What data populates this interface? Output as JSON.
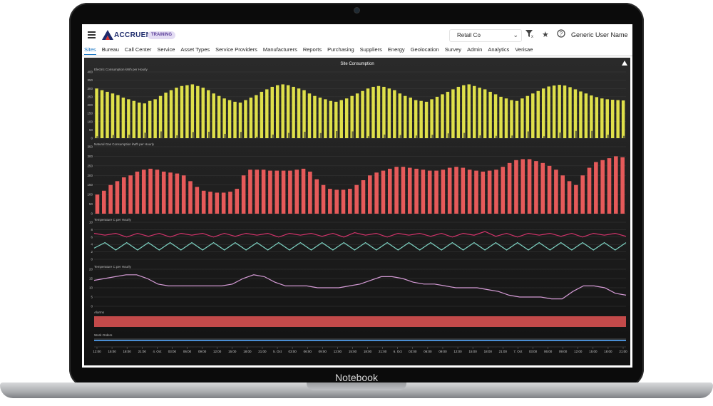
{
  "device": {
    "brand": "Notebook"
  },
  "app": {
    "logo_text": "ACCRUENT",
    "env_badge": "TRAINING",
    "company_select": "Retail Co",
    "user_name": "Generic User Name",
    "icons": {
      "menu": "hamburger-icon",
      "filter": "filter-icon",
      "favorite": "star-icon",
      "help": "help-icon"
    }
  },
  "nav": {
    "items": [
      {
        "label": "Sites",
        "active": true
      },
      {
        "label": "Bureau"
      },
      {
        "label": "Call Center"
      },
      {
        "label": "Service"
      },
      {
        "label": "Asset Types"
      },
      {
        "label": "Service Providers"
      },
      {
        "label": "Manufacturers"
      },
      {
        "label": "Reports"
      },
      {
        "label": "Purchasing"
      },
      {
        "label": "Suppliers"
      },
      {
        "label": "Energy"
      },
      {
        "label": "Geolocation"
      },
      {
        "label": "Survey"
      },
      {
        "label": "Admin"
      },
      {
        "label": "Analytics"
      },
      {
        "label": "Verisae"
      }
    ]
  },
  "chart_data": {
    "type": "line",
    "title": "Site Consumption",
    "colors": {
      "electric": "#dfe04a",
      "electric_secondary": "#6b6b3a",
      "gas": "#e65a5a",
      "temp_high": "#d6336c",
      "temp_low": "#7ed3c3",
      "temp_single": "#d59bd6",
      "alarms": "#c34a4a",
      "work_orders": "#4a8ed4"
    },
    "x_ticks": [
      "12:00",
      "15:00",
      "18:00",
      "21:00",
      "4. Oct",
      "03:00",
      "06:00",
      "09:00",
      "12:00",
      "15:00",
      "18:00",
      "21:00",
      "5. Oct",
      "03:00",
      "06:00",
      "09:00",
      "12:00",
      "15:00",
      "18:00",
      "21:00",
      "6. Oct",
      "03:00",
      "06:00",
      "09:00",
      "12:00",
      "15:00",
      "18:00",
      "21:00",
      "7. Oct",
      "03:00",
      "06:00",
      "09:00",
      "12:00",
      "15:00",
      "18:00",
      "21:00"
    ],
    "panels": [
      {
        "key": "electric",
        "label": "Electric Consumption kWh per Hourly",
        "yticks": [
          "400",
          "350",
          "300",
          "250",
          "200",
          "150",
          "100",
          "50",
          "0"
        ],
        "ymax": 400,
        "type": "bar",
        "values": [
          300,
          290,
          280,
          270,
          260,
          245,
          235,
          225,
          215,
          210,
          225,
          235,
          255,
          275,
          290,
          305,
          315,
          320,
          325,
          315,
          305,
          290,
          270,
          255,
          240,
          230,
          220,
          215,
          230,
          245,
          260,
          280,
          295,
          310,
          320,
          325,
          320,
          310,
          300,
          290,
          270,
          255,
          245,
          235,
          225,
          220,
          230,
          240,
          255,
          270,
          285,
          300,
          310,
          315,
          310,
          300,
          290,
          270,
          255,
          245,
          230,
          225,
          220,
          235,
          250,
          265,
          280,
          295,
          310,
          320,
          325,
          315,
          305,
          295,
          280,
          265,
          250,
          240,
          230,
          225,
          240,
          255,
          270,
          285,
          300,
          312,
          318,
          322,
          318,
          308,
          295,
          282,
          270,
          258,
          248,
          240,
          235,
          232,
          230,
          228
        ]
      },
      {
        "key": "gas",
        "label": "Natural Gas Consumption kWh per Hourly",
        "yticks": [
          "350",
          "300",
          "250",
          "200",
          "150",
          "100",
          "50",
          "0"
        ],
        "ymax": 350,
        "type": "bar",
        "values": [
          100,
          120,
          150,
          170,
          190,
          200,
          220,
          230,
          235,
          230,
          220,
          215,
          210,
          200,
          170,
          140,
          120,
          115,
          110,
          110,
          115,
          130,
          200,
          230,
          230,
          230,
          225,
          225,
          225,
          225,
          230,
          235,
          220,
          180,
          150,
          130,
          125,
          125,
          130,
          150,
          175,
          200,
          215,
          225,
          235,
          245,
          245,
          240,
          235,
          230,
          225,
          225,
          230,
          240,
          245,
          240,
          230,
          225,
          220,
          225,
          230,
          245,
          265,
          280,
          285,
          285,
          275,
          265,
          250,
          230,
          200,
          170,
          150,
          200,
          240,
          270,
          280,
          290,
          300,
          295
        ]
      },
      {
        "key": "temp_dual",
        "label": "Temperature C per Hourly",
        "yticks": [
          "10",
          "8",
          "6",
          "4",
          "2",
          "0"
        ],
        "ymax": 10,
        "type": "line",
        "high": [
          7,
          6.5,
          7,
          6,
          7,
          6.2,
          7,
          6,
          7,
          6.5,
          7,
          6,
          7,
          6.2,
          7,
          6.5,
          7,
          6,
          7,
          6.5,
          7,
          6.2,
          7,
          6,
          7.2,
          6.5,
          7,
          6,
          7,
          6.5,
          7,
          6.2,
          7,
          6,
          7,
          6.5,
          7.5,
          6.2,
          7,
          6,
          7,
          6.5,
          7,
          6.2,
          7,
          6,
          7,
          6.5,
          7,
          6.2
        ],
        "low": [
          3,
          4.5,
          2.5,
          4.5,
          2.5,
          4.5,
          2.5,
          4.5,
          2.5,
          4.5,
          2.5,
          4.5,
          2.5,
          4.5,
          2.5,
          4.5,
          2.5,
          4.5,
          2.5,
          4.5,
          2.5,
          4.5,
          2.5,
          4.5,
          2.5,
          4.5,
          2.5,
          4.5,
          2.5,
          4.5,
          2.5,
          4.5,
          2.5,
          4.5,
          2.5,
          4.5,
          2.5,
          4.5,
          2.5,
          4.5,
          2.5,
          4.5,
          2.5,
          4.5,
          2.5,
          4.5,
          2.5,
          4.5,
          2.5,
          4.5
        ]
      },
      {
        "key": "temp_single",
        "label": "Temperature C per Hourly",
        "yticks": [
          "20",
          "15",
          "10",
          "5",
          "0"
        ],
        "ymax": 20,
        "type": "line",
        "values": [
          14,
          15,
          16,
          17,
          17,
          15,
          12,
          11,
          11,
          11,
          11,
          11,
          11,
          12,
          15,
          17,
          16,
          13,
          11,
          11,
          11,
          10,
          10,
          10,
          11,
          12,
          14,
          16,
          16,
          15,
          13,
          12,
          12,
          11,
          10,
          10,
          10,
          9,
          8,
          6,
          5,
          5,
          5,
          4,
          4,
          8,
          11,
          11,
          10,
          7,
          6
        ]
      },
      {
        "key": "alarms",
        "label": "Alarms",
        "type": "band"
      },
      {
        "key": "work_orders",
        "label": "Work Orders",
        "type": "band"
      }
    ]
  }
}
